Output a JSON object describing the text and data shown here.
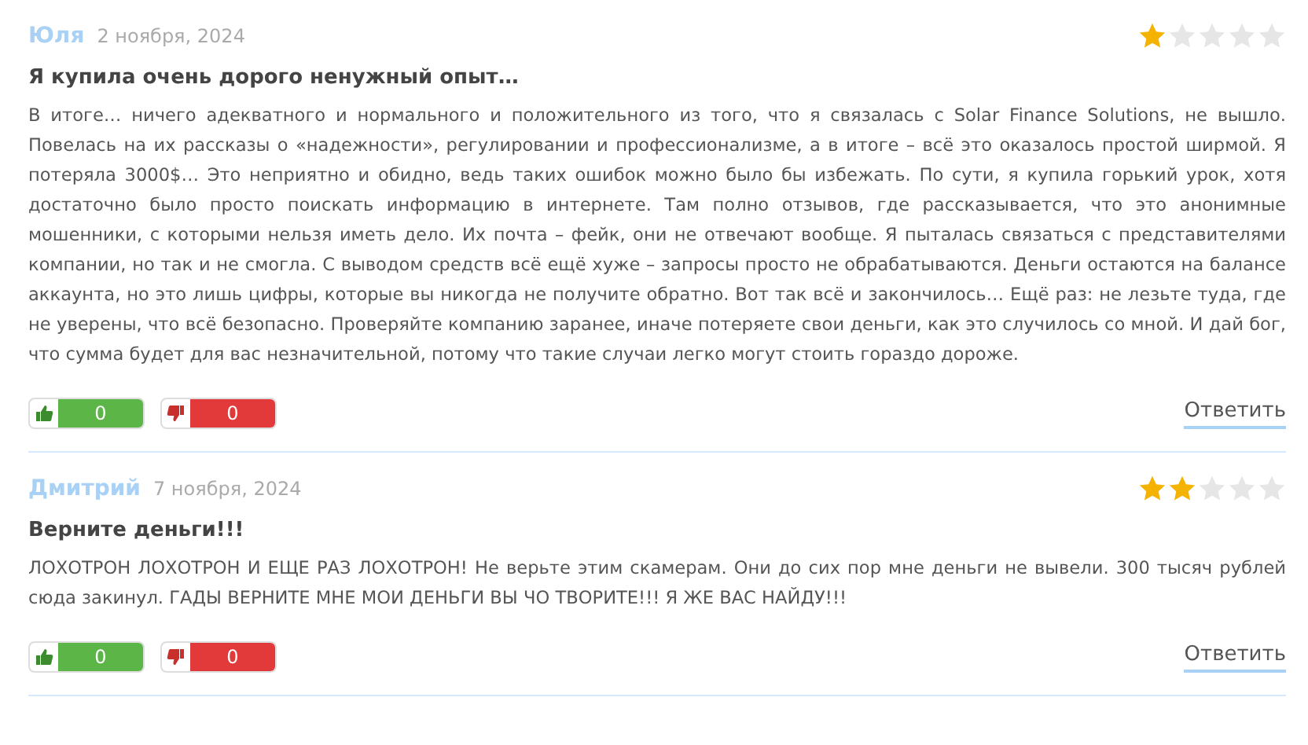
{
  "reviews": [
    {
      "author": "Юля",
      "date": "2 ноября, 2024",
      "stars": 1,
      "title": "Я купила очень дорого ненужный опыт…",
      "text": "В итоге… ничего адекватного и нормального и положительного из того, что я связалась с Solar Finance Solutions, не вышло. Повелась на их рассказы о «надежности», регулировании и профессионализме, а в итоге – всё это оказалось простой ширмой. Я потеряла 3000$… Это неприятно и обидно, ведь таких ошибок можно было бы избежать. По сути, я купила горький урок, хотя достаточно было просто поискать информацию в интернете. Там полно отзывов, где рассказывается, что это анонимные мошенники, с которыми нельзя иметь дело. Их почта – фейк, они не отвечают вообще. Я пыталась связаться с представителями компании, но так и не смогла. С выводом средств всё ещё хуже – запросы просто не обрабатываются. Деньги остаются на балансе аккаунта, но это лишь цифры, которые вы никогда не получите обратно. Вот так всё и закончилось… Ещё раз: не лезьте туда, где не уверены, что всё безопасно. Проверяйте компанию заранее, иначе потеряете свои деньги, как это случилось со мной. И дай бог, что сумма будет для вас незначительной, потому что такие случаи легко могут стоить гораздо дороже.",
      "likes": "0",
      "dislikes": "0",
      "reply": "Ответить"
    },
    {
      "author": "Дмитрий",
      "date": "7 ноября, 2024",
      "stars": 2,
      "title": "Верните деньги!!!",
      "text": "ЛОХОТРОН ЛОХОТРОН И ЕЩЕ РАЗ ЛОХОТРОН! Не верьте этим скамерам. Они до сих пор мне деньги не вывели. 300 тысяч рублей сюда закинул. ГАДЫ ВЕРНИТЕ МНЕ МОИ ДЕНЬГИ ВЫ ЧО ТВОРИТЕ!!! Я ЖЕ ВАС НАЙДУ!!!",
      "likes": "0",
      "dislikes": "0",
      "reply": "Ответить"
    }
  ]
}
